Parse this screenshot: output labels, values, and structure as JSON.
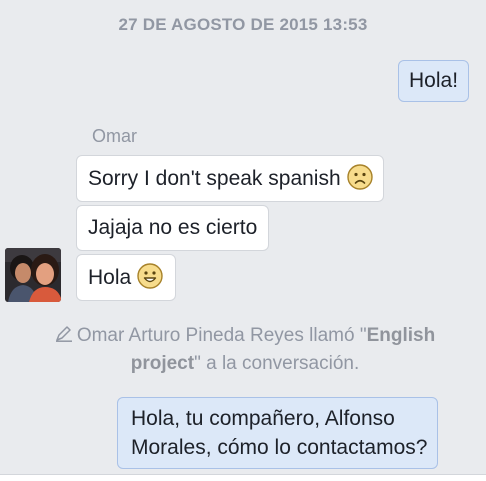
{
  "thread": {
    "timestamp": "27 DE AGOSTO DE 2015 13:53",
    "sender_name": "Omar",
    "messages": [
      {
        "text": "Hola!",
        "direction": "outgoing"
      },
      {
        "text": "Sorry I don't speak spanish",
        "emoji": "frown-emoji",
        "direction": "incoming"
      },
      {
        "text": "Jajaja no es cierto",
        "direction": "incoming"
      },
      {
        "text": "Hola",
        "emoji": "smile-emoji",
        "direction": "incoming"
      }
    ],
    "system_message": {
      "icon": "pencil-icon",
      "pre": "Omar Arturo Pineda Reyes llamó \"",
      "bold": "English project",
      "post": "\" a la conversación."
    },
    "last_message": {
      "line1": "Hola, tu compañero, Alfonso",
      "line2": "Morales, cómo lo contactamos?",
      "direction": "outgoing"
    }
  },
  "colors": {
    "background": "#e9ebee",
    "outgoing_bubble": "#dce8f8",
    "incoming_bubble": "#ffffff",
    "muted_text": "#9197a3"
  }
}
